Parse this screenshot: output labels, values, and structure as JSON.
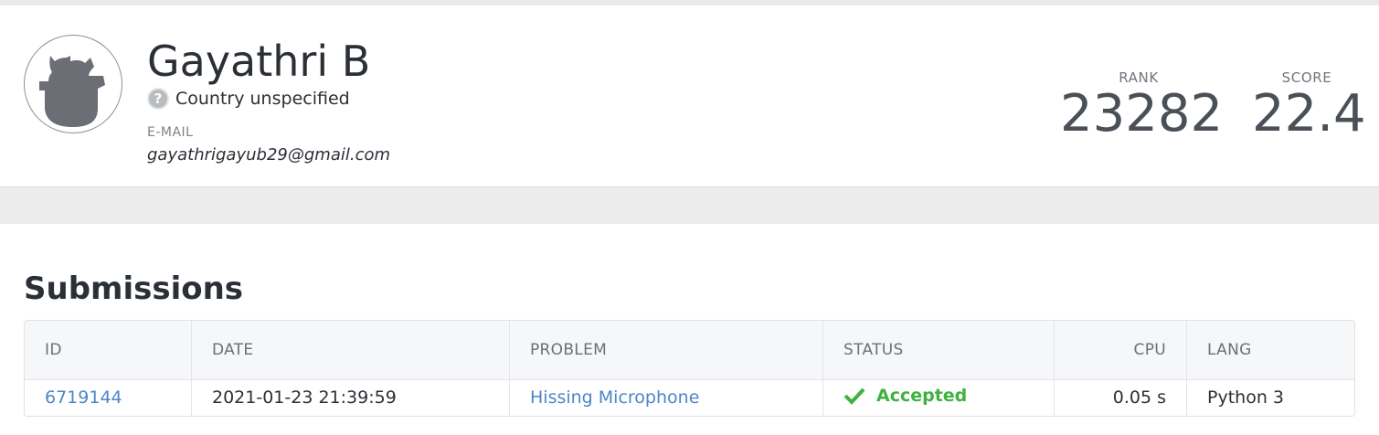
{
  "profile": {
    "name": "Gayathri B",
    "country": "Country unspecified",
    "email_label": "E-MAIL",
    "email": "gayathrigayub29@gmail.com",
    "rank_label": "RANK",
    "rank": "23282",
    "score_label": "SCORE",
    "score": "22.4"
  },
  "submissions": {
    "title": "Submissions",
    "columns": [
      "ID",
      "DATE",
      "PROBLEM",
      "STATUS",
      "CPU",
      "LANG"
    ],
    "rows": [
      {
        "id": "6719144",
        "date": "2021-01-23 21:39:59",
        "problem": "Hissing Microphone",
        "status": "Accepted",
        "cpu": "0.05 s",
        "lang": "Python 3"
      }
    ]
  },
  "icons": {
    "avatar": "default-avatar-icon",
    "country": "question-mark-icon",
    "status": "check-icon"
  },
  "colors": {
    "link": "#4d86c6",
    "accepted": "#3fb23f"
  }
}
